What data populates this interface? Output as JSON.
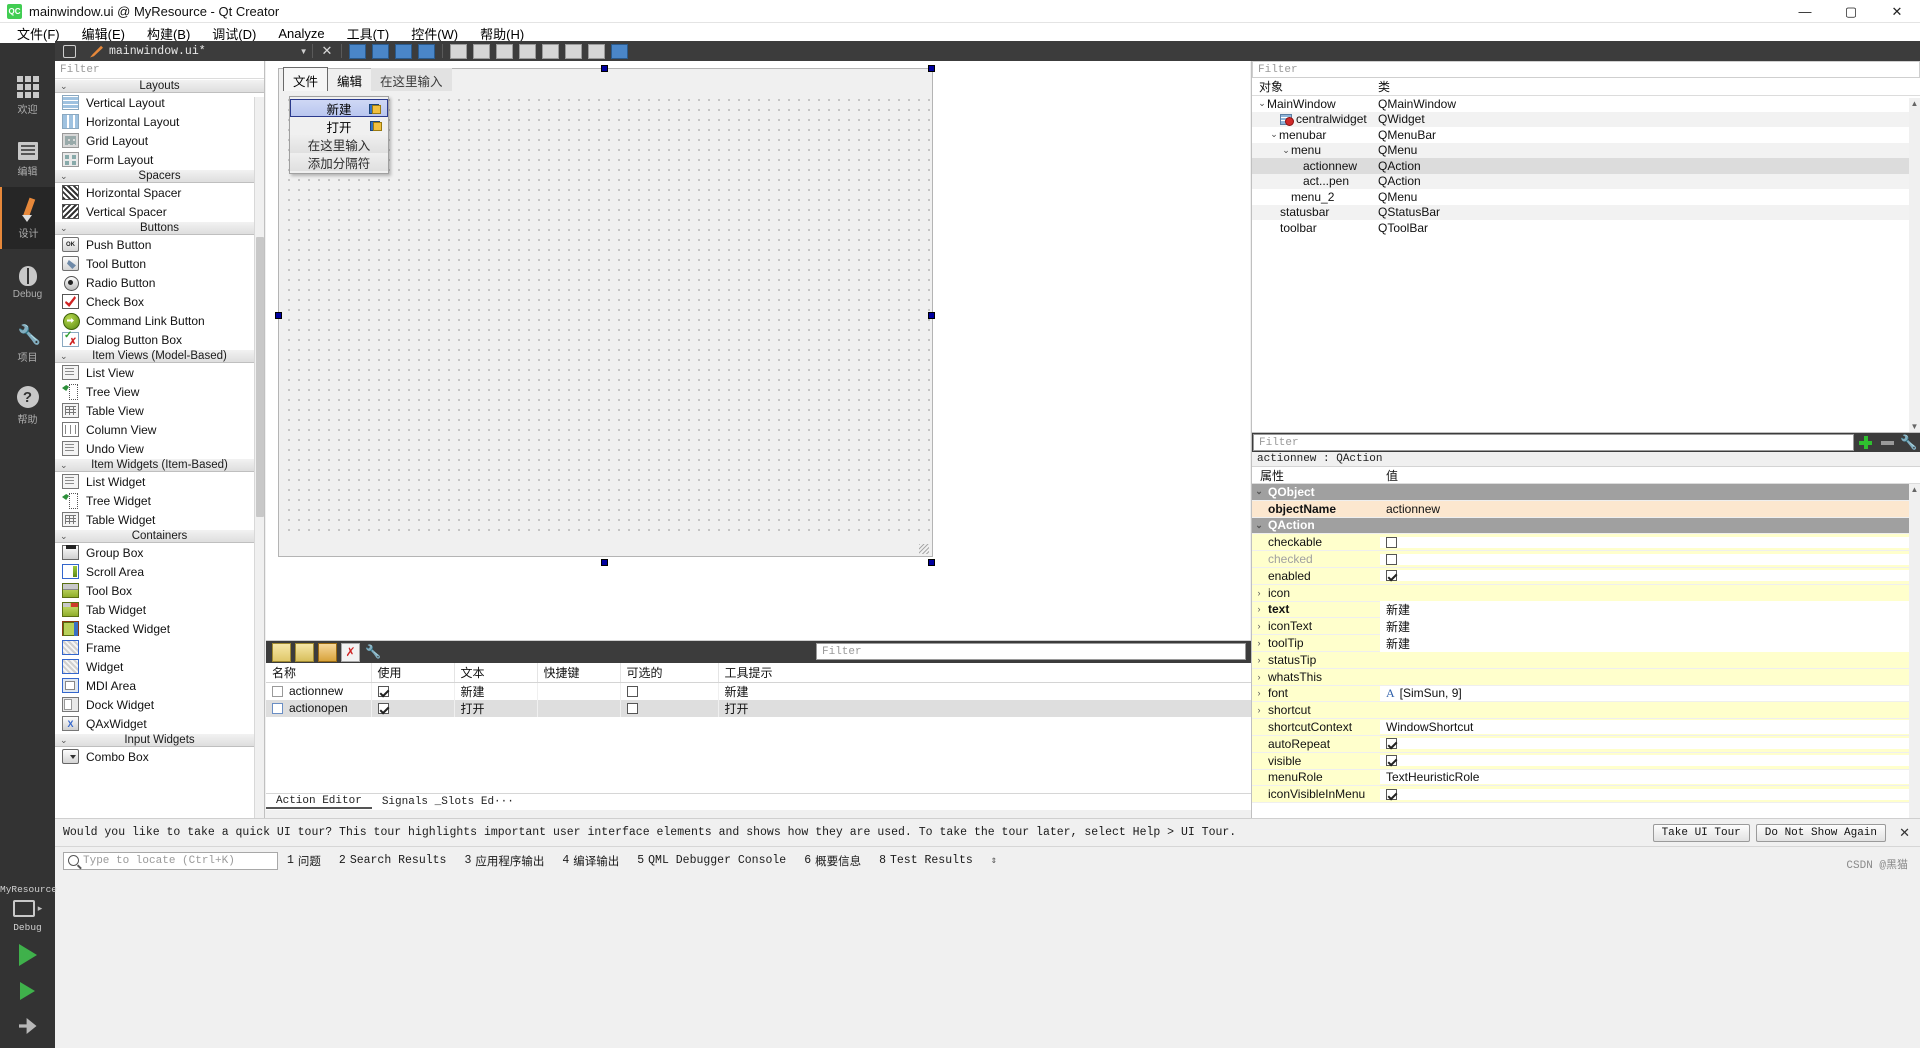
{
  "window": {
    "title": "mainwindow.ui @ MyResource - Qt Creator",
    "logo": "QC",
    "minimize": "—",
    "maximize": "▢",
    "close": "✕"
  },
  "menubar": [
    {
      "label": "文件(F)"
    },
    {
      "label": "编辑(E)"
    },
    {
      "label": "构建(B)"
    },
    {
      "label": "调试(D)"
    },
    {
      "label": "Analyze"
    },
    {
      "label": "工具(T)"
    },
    {
      "label": "控件(W)"
    },
    {
      "label": "帮助(H)"
    }
  ],
  "modebar": [
    {
      "label": "欢迎",
      "icon": "grid-icon"
    },
    {
      "label": "编辑",
      "icon": "lines-icon"
    },
    {
      "label": "设计",
      "icon": "pencil-icon"
    },
    {
      "label": "Debug",
      "icon": "bug-icon"
    },
    {
      "label": "项目",
      "icon": "wrench-icon"
    },
    {
      "label": "帮助",
      "icon": "question-icon"
    }
  ],
  "modebar_bottom": {
    "project_name": "MyResource",
    "run_config": "Debug"
  },
  "editor_tab": {
    "document_name": "mainwindow.ui*",
    "lock_icon": "lock-icon",
    "close_icon": "close-icon",
    "dropdown_icon": "chevron-down-icon"
  },
  "widget_box": {
    "filter_placeholder": "Filter",
    "groups": [
      {
        "name": "Layouts",
        "items": [
          {
            "label": "Vertical Layout",
            "icon": "vertical-layout-icon",
            "cls": "ic-vlayout"
          },
          {
            "label": "Horizontal Layout",
            "icon": "horizontal-layout-icon",
            "cls": "ic-hlayout"
          },
          {
            "label": "Grid Layout",
            "icon": "grid-layout-icon",
            "cls": "ic-grid"
          },
          {
            "label": "Form Layout",
            "icon": "form-layout-icon",
            "cls": "ic-form"
          }
        ]
      },
      {
        "name": "Spacers",
        "items": [
          {
            "label": "Horizontal Spacer",
            "icon": "horizontal-spacer-icon",
            "cls": "ic-hspacer"
          },
          {
            "label": "Vertical Spacer",
            "icon": "vertical-spacer-icon",
            "cls": "ic-vspacer"
          }
        ]
      },
      {
        "name": "Buttons",
        "items": [
          {
            "label": "Push Button",
            "icon": "push-button-icon",
            "cls": "ic-push",
            "glyph": "OK"
          },
          {
            "label": "Tool Button",
            "icon": "tool-button-icon",
            "cls": "ic-tool"
          },
          {
            "label": "Radio Button",
            "icon": "radio-button-icon",
            "cls": "ic-radio"
          },
          {
            "label": "Check Box",
            "icon": "check-box-icon",
            "cls": "ic-check"
          },
          {
            "label": "Command Link Button",
            "icon": "command-link-icon",
            "cls": "ic-cmdlink"
          },
          {
            "label": "Dialog Button Box",
            "icon": "dialog-button-box-icon",
            "cls": "ic-dlgbtn"
          }
        ]
      },
      {
        "name": "Item Views (Model-Based)",
        "items": [
          {
            "label": "List View",
            "icon": "list-view-icon",
            "cls": "ic-listview"
          },
          {
            "label": "Tree View",
            "icon": "tree-view-icon",
            "cls": "ic-treeview"
          },
          {
            "label": "Table View",
            "icon": "table-view-icon",
            "cls": "ic-tableview"
          },
          {
            "label": "Column View",
            "icon": "column-view-icon",
            "cls": "ic-colview"
          },
          {
            "label": "Undo View",
            "icon": "undo-view-icon",
            "cls": "ic-listview"
          }
        ]
      },
      {
        "name": "Item Widgets (Item-Based)",
        "items": [
          {
            "label": "List Widget",
            "icon": "list-widget-icon",
            "cls": "ic-listview"
          },
          {
            "label": "Tree Widget",
            "icon": "tree-widget-icon",
            "cls": "ic-treeview"
          },
          {
            "label": "Table Widget",
            "icon": "table-widget-icon",
            "cls": "ic-tableview"
          }
        ]
      },
      {
        "name": "Containers",
        "items": [
          {
            "label": "Group Box",
            "icon": "group-box-icon",
            "cls": "ic-groupbox"
          },
          {
            "label": "Scroll Area",
            "icon": "scroll-area-icon",
            "cls": "ic-scrollarea"
          },
          {
            "label": "Tool Box",
            "icon": "tool-box-icon",
            "cls": "ic-toolbox"
          },
          {
            "label": "Tab Widget",
            "icon": "tab-widget-icon",
            "cls": "ic-tabwidget"
          },
          {
            "label": "Stacked Widget",
            "icon": "stacked-widget-icon",
            "cls": "ic-stacked"
          },
          {
            "label": "Frame",
            "icon": "frame-icon",
            "cls": "ic-frame"
          },
          {
            "label": "Widget",
            "icon": "widget-icon",
            "cls": "ic-widget"
          },
          {
            "label": "MDI Area",
            "icon": "mdi-area-icon",
            "cls": "ic-mdi"
          },
          {
            "label": "Dock Widget",
            "icon": "dock-widget-icon",
            "cls": "ic-dock"
          },
          {
            "label": "QAxWidget",
            "icon": "qax-widget-icon",
            "cls": "ic-qax"
          }
        ]
      },
      {
        "name": "Input Widgets",
        "items": [
          {
            "label": "Combo Box",
            "icon": "combo-box-icon",
            "cls": "ic-combo"
          }
        ]
      }
    ]
  },
  "designer": {
    "form_menubar": [
      {
        "label": "文件",
        "state": "selected"
      },
      {
        "label": "编辑",
        "state": "normal"
      },
      {
        "label": "在这里输入",
        "state": "placeholder"
      }
    ],
    "popup_menu": [
      {
        "label": "新建",
        "state": "selected",
        "badge": true
      },
      {
        "label": "打开",
        "state": "normal",
        "badge": true
      },
      {
        "label": "在这里输入",
        "state": "ghost",
        "badge": false
      },
      {
        "label": "添加分隔符",
        "state": "ghost",
        "badge": false
      }
    ]
  },
  "action_editor": {
    "filter_placeholder": "Filter",
    "toolbar_icons": [
      "new-action-icon",
      "copy-action-icon",
      "edit-action-icon",
      "delete-action-icon",
      "configure-icon"
    ],
    "columns": [
      "名称",
      "使用",
      "文本",
      "快捷键",
      "可选的",
      "工具提示"
    ],
    "rows": [
      {
        "name": "actionnew",
        "used": true,
        "text": "新建",
        "shortcut": "",
        "checkable": false,
        "tooltip": "新建"
      },
      {
        "name": "actionopen",
        "used": true,
        "text": "打开",
        "shortcut": "",
        "checkable": false,
        "tooltip": "打开"
      }
    ],
    "tabs": [
      {
        "label": "Action Editor",
        "active": true
      },
      {
        "label": "Signals _Slots Ed···",
        "active": false
      }
    ]
  },
  "object_inspector": {
    "filter_placeholder": "Filter",
    "columns": [
      "对象",
      "类"
    ],
    "rows": [
      {
        "name": "MainWindow",
        "cls": "QMainWindow",
        "indent": 0,
        "chevron": "v",
        "icon": false,
        "selected": false,
        "shade": false
      },
      {
        "name": "centralwidget",
        "cls": "QWidget",
        "indent": 1,
        "chevron": "",
        "icon": true,
        "selected": false,
        "shade": true
      },
      {
        "name": "menubar",
        "cls": "QMenuBar",
        "indent": 1,
        "chevron": "v",
        "icon": false,
        "selected": false,
        "shade": false
      },
      {
        "name": "menu",
        "cls": "QMenu",
        "indent": 2,
        "chevron": "v",
        "icon": false,
        "selected": false,
        "shade": true
      },
      {
        "name": "actionnew",
        "cls": "QAction",
        "indent": 3,
        "chevron": "",
        "icon": false,
        "selected": true,
        "shade": false
      },
      {
        "name": "act...pen",
        "cls": "QAction",
        "indent": 3,
        "chevron": "",
        "icon": false,
        "selected": false,
        "shade": true
      },
      {
        "name": "menu_2",
        "cls": "QMenu",
        "indent": 2,
        "chevron": "",
        "icon": false,
        "selected": false,
        "shade": false
      },
      {
        "name": "statusbar",
        "cls": "QStatusBar",
        "indent": 1,
        "chevron": "",
        "icon": false,
        "selected": false,
        "shade": true
      },
      {
        "name": "toolbar",
        "cls": "QToolBar",
        "indent": 1,
        "chevron": "",
        "icon": false,
        "selected": false,
        "shade": false
      }
    ]
  },
  "property_editor": {
    "filter_placeholder": "Filter",
    "add_label": "+",
    "remove_label": "—",
    "configure_icon": "wrench-icon",
    "object_line": "actionnew : QAction",
    "columns": [
      "属性",
      "值"
    ],
    "rows": [
      {
        "name": "QObject",
        "value": "",
        "kind": "group",
        "expander": "v"
      },
      {
        "name": "objectName",
        "value": "actionnew",
        "kind": "obj",
        "expander": ""
      },
      {
        "name": "QAction",
        "value": "",
        "kind": "group",
        "expander": "v"
      },
      {
        "name": "checkable",
        "value": "",
        "kind": "check",
        "expander": "",
        "checked": false
      },
      {
        "name": "checked",
        "value": "",
        "kind": "check",
        "expander": "",
        "checked": false,
        "disabled": true
      },
      {
        "name": "enabled",
        "value": "",
        "kind": "check",
        "expander": "",
        "checked": true
      },
      {
        "name": "icon",
        "value": "",
        "kind": "plain",
        "expander": ">"
      },
      {
        "name": "text",
        "value": "新建",
        "kind": "bold",
        "expander": ">"
      },
      {
        "name": "iconText",
        "value": "新建",
        "kind": "plain",
        "expander": ">"
      },
      {
        "name": "toolTip",
        "value": "新建",
        "kind": "plain",
        "expander": ">"
      },
      {
        "name": "statusTip",
        "value": "",
        "kind": "plain",
        "expander": ">"
      },
      {
        "name": "whatsThis",
        "value": "",
        "kind": "plain",
        "expander": ">"
      },
      {
        "name": "font",
        "value": "[SimSun, 9]",
        "kind": "font",
        "expander": ">"
      },
      {
        "name": "shortcut",
        "value": "",
        "kind": "plain",
        "expander": ">"
      },
      {
        "name": "shortcutContext",
        "value": "WindowShortcut",
        "kind": "plain",
        "expander": ""
      },
      {
        "name": "autoRepeat",
        "value": "",
        "kind": "check",
        "expander": "",
        "checked": true
      },
      {
        "name": "visible",
        "value": "",
        "kind": "check",
        "expander": "",
        "checked": true
      },
      {
        "name": "menuRole",
        "value": "TextHeuristicRole",
        "kind": "plain",
        "expander": ""
      },
      {
        "name": "iconVisibleInMenu",
        "value": "",
        "kind": "check",
        "expander": "",
        "checked": true
      }
    ]
  },
  "tour_bar": {
    "message": "Would you like to take a quick UI tour? This tour highlights important user interface elements and shows how they are used. To take the tour later, select Help > UI Tour.",
    "take_tour": "Take UI Tour",
    "dismiss": "Do Not Show Again",
    "close": "✕"
  },
  "status_bar": {
    "locate_placeholder": "Type to locate (Ctrl+K)",
    "search_icon": "search-icon",
    "items": [
      {
        "num": "1",
        "label": "问题"
      },
      {
        "num": "2",
        "label": "Search Results"
      },
      {
        "num": "3",
        "label": "应用程序输出"
      },
      {
        "num": "4",
        "label": "编译输出"
      },
      {
        "num": "5",
        "label": "QML Debugger Console"
      },
      {
        "num": "6",
        "label": "概要信息"
      },
      {
        "num": "8",
        "label": "Test Results"
      }
    ],
    "arrows": "⇕",
    "watermark": "CSDN @黑猫"
  },
  "colors": {
    "accent": "#e7883a",
    "modebar_bg": "#333333",
    "selection": "#b9c6ef",
    "group_row": "#a0a0a0",
    "obj_row": "#fce7cf",
    "yellow_row": "#ffffcc"
  }
}
